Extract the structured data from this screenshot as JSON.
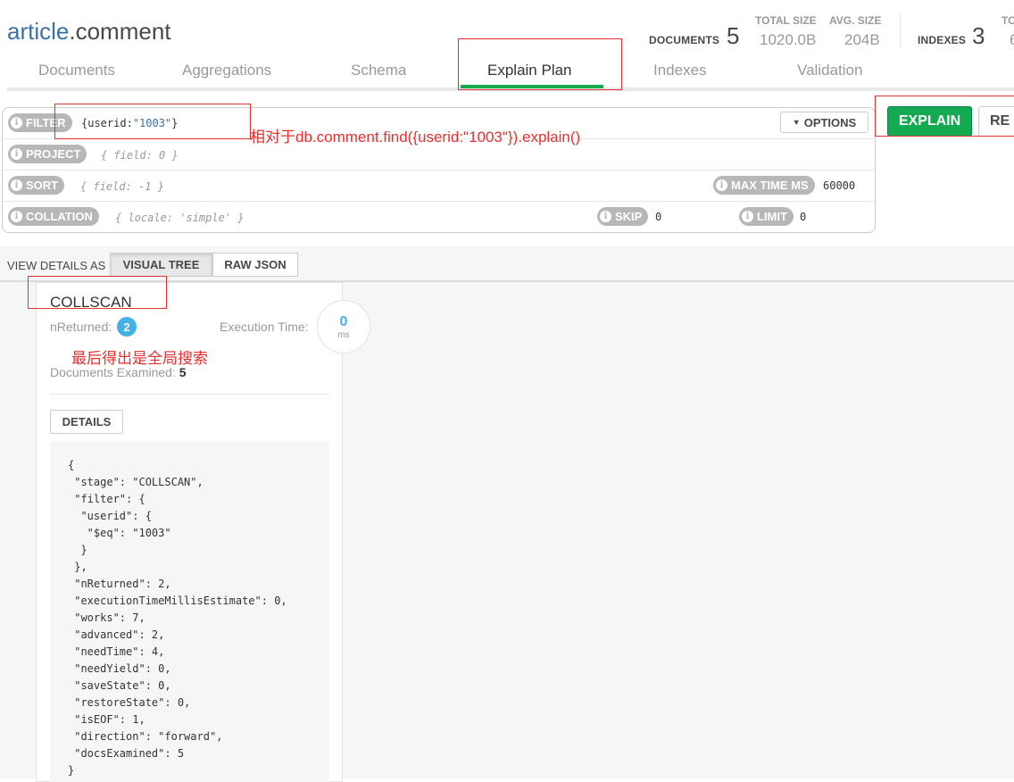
{
  "collection": {
    "db": "article",
    "name": ".comment"
  },
  "stats": {
    "documents_label": "DOCUMENTS",
    "documents_value": "5",
    "total_size_label": "TOTAL SIZE",
    "total_size_value": "1020.0B",
    "avg_size_label": "AVG. SIZE",
    "avg_size_value": "204B",
    "indexes_label": "INDEXES",
    "indexes_value": "3",
    "total_index_label_partial": "TO",
    "total_index_value_partial": "6"
  },
  "tabs": [
    {
      "label": "Documents"
    },
    {
      "label": "Aggregations"
    },
    {
      "label": "Schema"
    },
    {
      "label": "Explain Plan",
      "active": true
    },
    {
      "label": "Indexes"
    },
    {
      "label": "Validation"
    }
  ],
  "query": {
    "filter_label": "FILTER",
    "filter_open": "{userid:",
    "filter_string": "\"1003\"",
    "filter_close": "}",
    "project_label": "PROJECT",
    "project_placeholder": "{ field: 0 }",
    "sort_label": "SORT",
    "sort_placeholder": "{ field: -1 }",
    "collation_label": "COLLATION",
    "collation_placeholder": "{ locale: 'simple' }",
    "max_time_label": "MAX TIME MS",
    "max_time_value": "60000",
    "skip_label": "SKIP",
    "skip_value": "0",
    "limit_label": "LIMIT",
    "limit_value": "0",
    "options_label": "OPTIONS",
    "explain_label": "EXPLAIN",
    "reset_label": "RE"
  },
  "view": {
    "label": "VIEW DETAILS AS",
    "visual_tree": "VISUAL TREE",
    "raw_json": "RAW JSON"
  },
  "stage": {
    "name": "COLLSCAN",
    "nreturned_label": "nReturned:",
    "nreturned_value": "2",
    "exec_time_label": "Execution Time:",
    "exec_time_value": "0",
    "exec_time_unit": "ms",
    "docs_examined_label": "Documents Examined:",
    "docs_examined_value": "5",
    "details_label": "DETAILS",
    "json": "{\n \"stage\": \"COLLSCAN\",\n \"filter\": {\n  \"userid\": {\n   \"$eq\": \"1003\"\n  }\n },\n \"nReturned\": 2,\n \"executionTimeMillisEstimate\": 0,\n \"works\": 7,\n \"advanced\": 2,\n \"needTime\": 4,\n \"needYield\": 0,\n \"saveState\": 0,\n \"restoreState\": 0,\n \"isEOF\": 1,\n \"direction\": \"forward\",\n \"docsExamined\": 5\n}"
  },
  "annotations": {
    "filter_note": "相对于db.comment.find({userid:\"1003\"}).explain()",
    "stage_note": "最后得出是全局搜索"
  },
  "colors": {
    "accent_green": "#13aa52",
    "annotation_red": "#e03030",
    "badge_blue": "#43b1e5"
  }
}
